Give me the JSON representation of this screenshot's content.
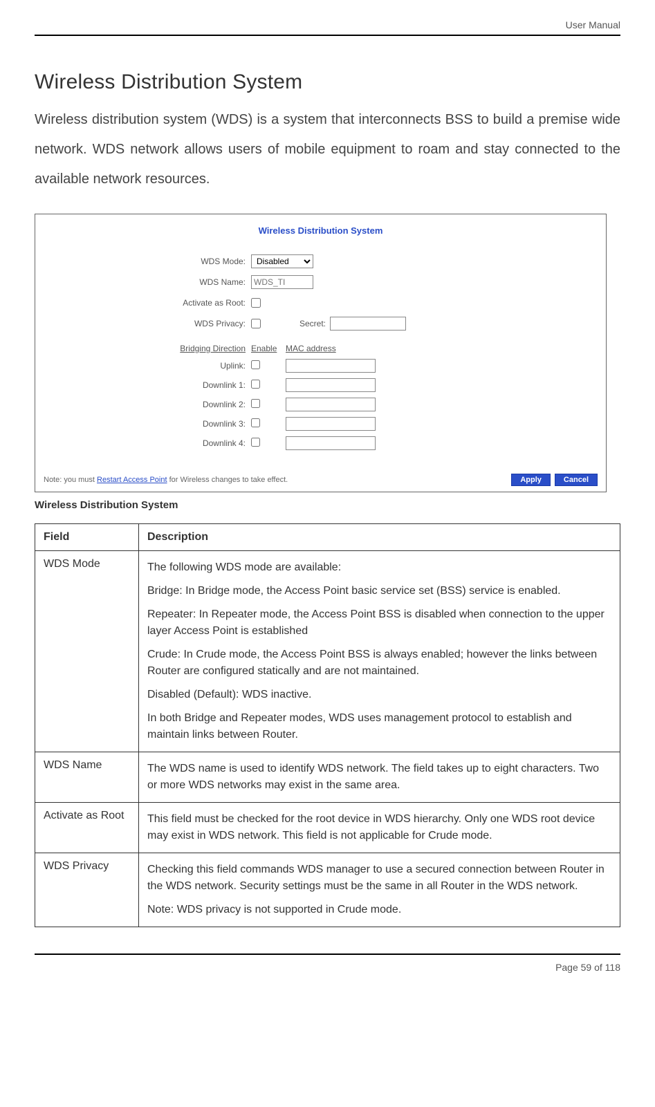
{
  "header": {
    "text": "User Manual"
  },
  "title": "Wireless Distribution System",
  "intro": "Wireless distribution system (WDS) is a system that interconnects BSS to build a premise wide network. WDS network allows users of mobile equipment to roam and stay connected to the available network resources.",
  "panel": {
    "title": "Wireless Distribution System",
    "wds_mode_label": "WDS Mode:",
    "wds_mode_value": "Disabled",
    "wds_name_label": "WDS Name:",
    "wds_name_placeholder": "WDS_TI",
    "activate_root_label": "Activate as Root:",
    "wds_privacy_label": "WDS Privacy:",
    "secret_label": "Secret:",
    "secret_value": "",
    "bridging_header": {
      "direction": "Bridging Direction",
      "enable": "Enable",
      "mac": "MAC address"
    },
    "rows": [
      {
        "label": "Uplink:",
        "mac": ""
      },
      {
        "label": "Downlink 1:",
        "mac": ""
      },
      {
        "label": "Downlink 2:",
        "mac": ""
      },
      {
        "label": "Downlink 3:",
        "mac": ""
      },
      {
        "label": "Downlink 4:",
        "mac": ""
      }
    ],
    "note_prefix": "Note: you must ",
    "note_link": "Restart Access Point",
    "note_suffix": " for Wireless changes to take effect.",
    "apply": "Apply",
    "cancel": "Cancel"
  },
  "caption": "Wireless Distribution System",
  "table": {
    "h_field": "Field",
    "h_desc": "Description",
    "rows": [
      {
        "field": "WDS Mode",
        "paras": [
          "The following WDS mode are available:",
          "Bridge: In Bridge mode, the Access Point basic service set (BSS) service is enabled.",
          "Repeater: In Repeater mode, the Access Point BSS is disabled when connection to the upper layer Access Point is established",
          "Crude: In Crude mode, the Access Point BSS is always enabled; however the links between Router are configured statically and are not maintained.",
          "Disabled (Default): WDS inactive.",
          "In both Bridge and Repeater modes, WDS uses management protocol to establish and maintain links between Router."
        ]
      },
      {
        "field": "WDS Name",
        "paras": [
          "The WDS name is used to identify WDS network. The field takes up to eight characters. Two or more WDS networks may exist in the same area."
        ]
      },
      {
        "field": "Activate as Root",
        "paras": [
          "This field must be checked for the root device in WDS hierarchy. Only one WDS root device may exist in WDS network. This field is not applicable for Crude mode."
        ]
      },
      {
        "field": "WDS Privacy",
        "paras": [
          "Checking this field commands WDS manager to use a secured connection between Router in the WDS network. Security settings must be the same in all Router in the WDS network.",
          "Note: WDS privacy is not supported in Crude mode."
        ]
      }
    ]
  },
  "footer": {
    "text": "Page 59 of 118"
  }
}
